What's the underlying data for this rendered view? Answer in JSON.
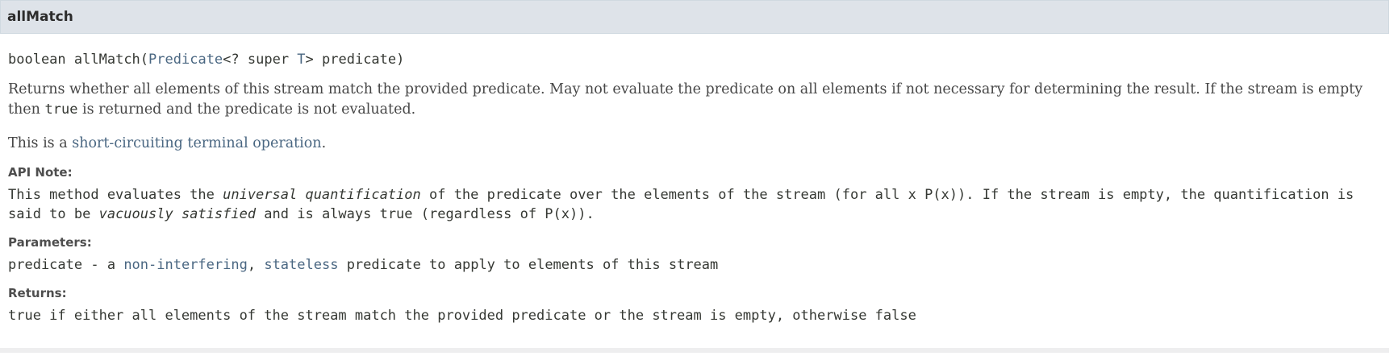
{
  "header": {
    "title": "allMatch"
  },
  "signature": {
    "return_type": "boolean",
    "method_name": "allMatch",
    "param_type_link": "Predicate",
    "generic_pre": "<? super ",
    "type_var_link": "T",
    "generic_post": "> predicate)"
  },
  "description": {
    "p1_a": "Returns whether all elements of this stream match the provided predicate. May not evaluate the predicate on all elements if not necessary for determining the result. If the stream is empty then ",
    "p1_code": "true",
    "p1_b": " is returned and the predicate is not evaluated.",
    "p2_a": "This is a ",
    "p2_link": "short-circuiting terminal operation",
    "p2_b": "."
  },
  "api_note": {
    "label": "API Note:",
    "a": "This method evaluates the ",
    "em1": "universal quantification",
    "b": " of the predicate over the elements of the stream (for all x P(x)). If the stream is empty, the quantification is said to be ",
    "em2": "vacuously satisfied",
    "c": " and is always true (regardless of P(x))."
  },
  "parameters": {
    "label": "Parameters:",
    "name": "predicate",
    "sep": " - a ",
    "link1": "non-interfering",
    "comma": ", ",
    "link2": "stateless",
    "rest": " predicate to apply to elements of this stream"
  },
  "returns": {
    "label": "Returns:",
    "text": "true if either all elements of the stream match the provided predicate or the stream is empty, otherwise false"
  }
}
